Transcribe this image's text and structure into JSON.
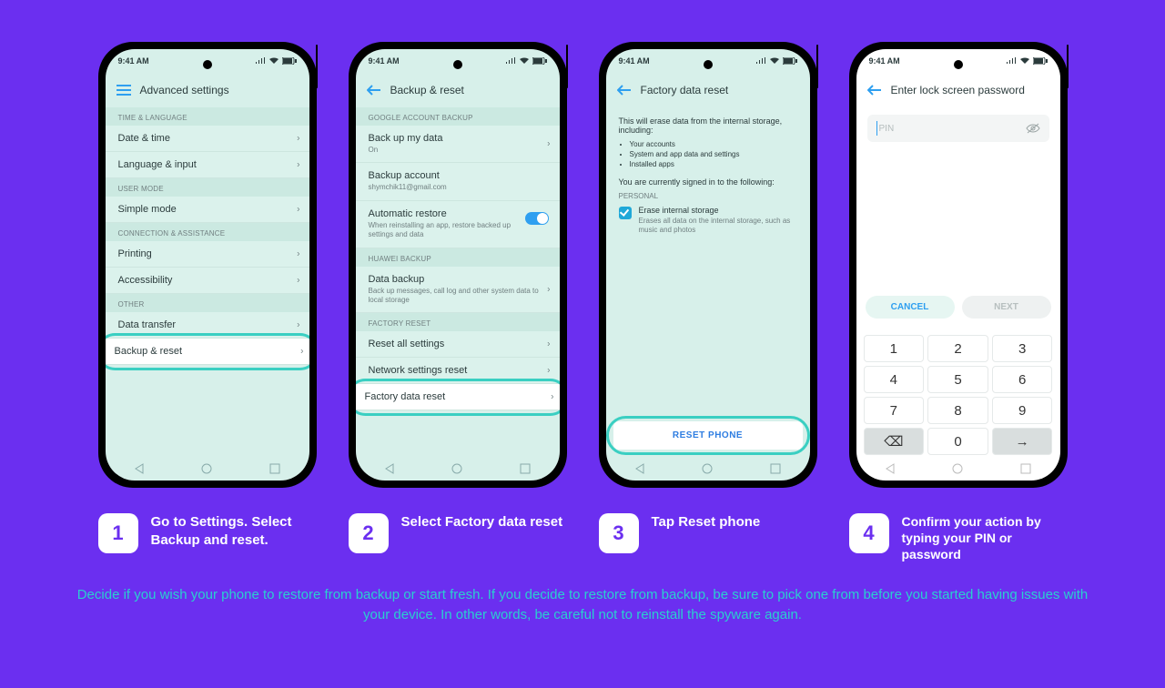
{
  "status": {
    "time": "9:41 AM"
  },
  "screen1": {
    "title": "Advanced settings",
    "sections": {
      "time_lang": "TIME & LANGUAGE",
      "user_mode": "USER MODE",
      "conn_assist": "CONNECTION & ASSISTANCE",
      "other": "OTHER"
    },
    "rows": {
      "date_time": "Date & time",
      "lang_input": "Language & input",
      "simple_mode": "Simple mode",
      "printing": "Printing",
      "accessibility": "Accessibility",
      "data_transfer": "Data transfer",
      "backup_reset": "Backup & reset"
    }
  },
  "screen2": {
    "title": "Backup & reset",
    "sections": {
      "google": "GOOGLE ACCOUNT BACKUP",
      "huawei": "HUAWEI BACKUP",
      "factory": "FACTORY RESET"
    },
    "rows": {
      "back_up_my_data": {
        "label": "Back up my data",
        "sub": "On"
      },
      "backup_account": {
        "label": "Backup account",
        "sub": "shymchik11@gmail.com"
      },
      "auto_restore": {
        "label": "Automatic restore",
        "sub": "When reinstalling an app, restore backed up settings and data"
      },
      "data_backup": {
        "label": "Data backup",
        "sub": "Back up messages, call log and other system data to local storage"
      },
      "reset_all": "Reset all settings",
      "network_reset": "Network settings reset",
      "factory_data_reset": "Factory data reset"
    }
  },
  "screen3": {
    "title": "Factory data reset",
    "intro": "This will erase data from the internal storage, including:",
    "bullets": [
      "Your accounts",
      "System and app data and settings",
      "Installed apps"
    ],
    "signed_in": "You are currently signed in to the following:",
    "personal_hdr": "PERSONAL",
    "erase": {
      "label": "Erase internal storage",
      "sub": "Erases all data on the internal storage, such as music and photos"
    },
    "reset_button": "RESET PHONE"
  },
  "screen4": {
    "title": "Enter lock screen password",
    "pin_placeholder": "PIN",
    "cancel": "CANCEL",
    "next": "NEXT",
    "keys": [
      "1",
      "2",
      "3",
      "4",
      "5",
      "6",
      "7",
      "8",
      "9",
      "",
      "0",
      ""
    ]
  },
  "captions": {
    "c1": "Go to Settings. Select Backup and reset.",
    "c2": "Select Factory data reset",
    "c3": "Tap Reset phone",
    "c4": "Confirm your action by typing your PIN or password"
  },
  "footer": "Decide if you wish your phone to restore from backup or start fresh. If you decide to restore from backup, be sure to pick one from before you started having issues with your device. In other words, be careful not to reinstall the spyware again."
}
